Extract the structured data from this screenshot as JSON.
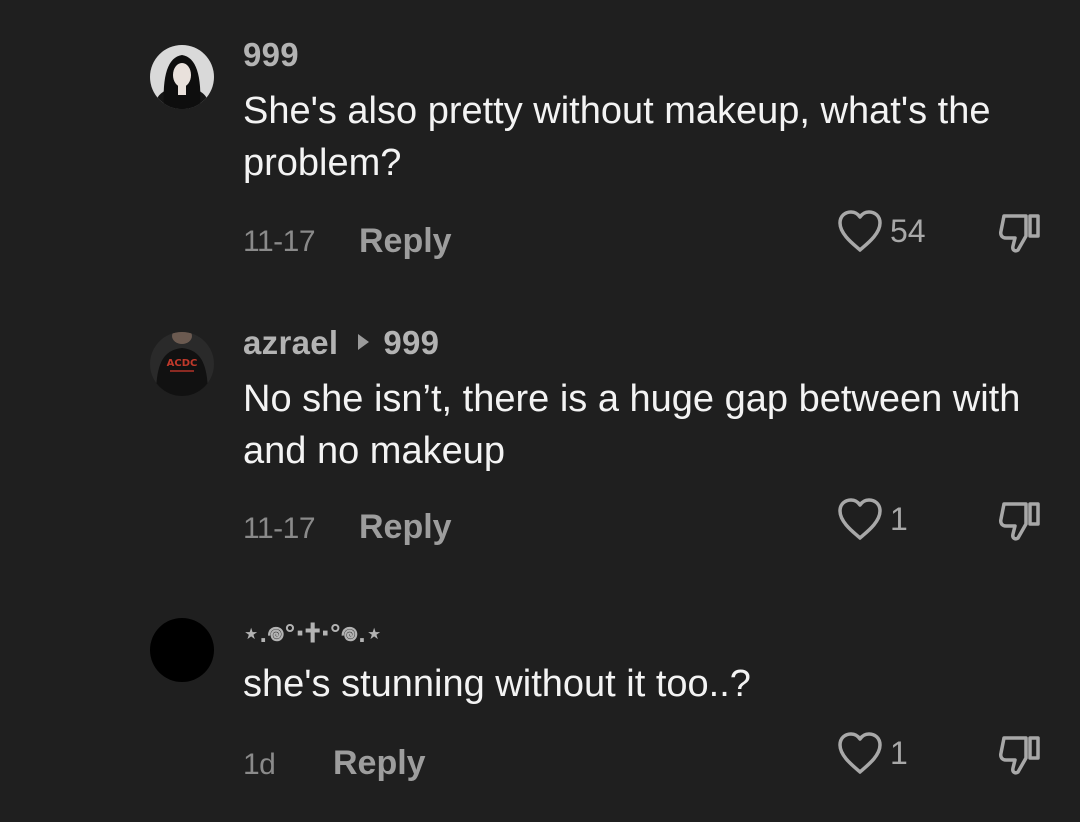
{
  "comments": [
    {
      "username": "999",
      "reply_to": "",
      "text": "She's also pretty without makeup, what's the problem?",
      "date": "11-17",
      "reply_label": "Reply",
      "likes": "54",
      "avatar_icon": "profile-photo-woman-dark-hair"
    },
    {
      "username": "azrael",
      "reply_to": "999",
      "text": "No she isn’t, there is a huge gap between with and no makeup",
      "date": "11-17",
      "reply_label": "Reply",
      "likes": "1",
      "avatar_icon": "profile-photo-acdc-shirt"
    },
    {
      "username": "⋆.𖦹°‧🕇‧°𖦹.⋆",
      "reply_to": "",
      "text": "she's stunning without it too..?",
      "date": "1d",
      "reply_label": "Reply",
      "likes": "1",
      "avatar_icon": "black-circle-avatar"
    }
  ],
  "icons": {
    "like": "heart-outline-icon",
    "dislike": "thumbs-down-outline-icon",
    "reply_indicator": "triangle-right-icon"
  },
  "colors": {
    "background": "#1f1f1f",
    "username": "#b3b3b3",
    "text": "#f3f3f3",
    "meta": "#8a8a8a"
  }
}
